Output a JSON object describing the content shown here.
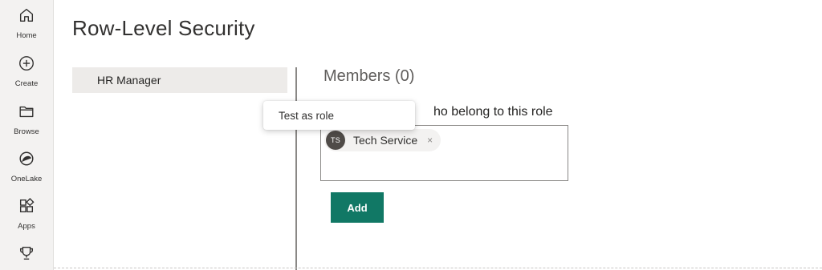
{
  "nav": {
    "items": [
      {
        "label": "Home",
        "icon": "home-icon"
      },
      {
        "label": "Create",
        "icon": "plus-circle-icon"
      },
      {
        "label": "Browse",
        "icon": "folder-icon"
      },
      {
        "label": "OneLake",
        "icon": "onelake-icon"
      },
      {
        "label": "Apps",
        "icon": "apps-icon"
      },
      {
        "label": "",
        "icon": "trophy-icon"
      }
    ]
  },
  "page": {
    "title": "Row-Level Security"
  },
  "roles": {
    "items": [
      {
        "label": "HR Manager"
      }
    ]
  },
  "context_menu": {
    "item": "Test as role"
  },
  "members": {
    "title": "Members (0)",
    "description_visible": "ho belong to this role",
    "chips": [
      {
        "initials": "TS",
        "name": "Tech Service",
        "remove": "×"
      }
    ],
    "add_label": "Add"
  },
  "colors": {
    "accent": "#117865",
    "rail_bg": "#f3f2f1",
    "selected_role_bg": "#edebe9",
    "avatar_bg": "#4f4b48"
  }
}
